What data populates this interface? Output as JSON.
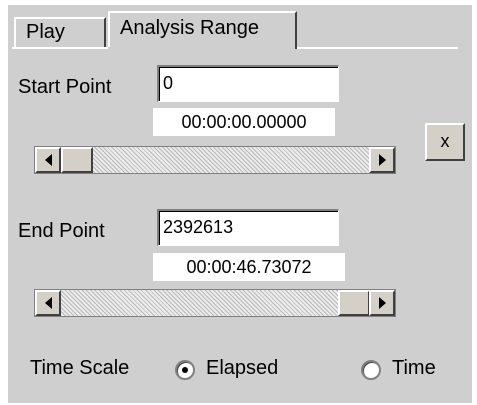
{
  "tabs": [
    {
      "label": "Play",
      "active": false
    },
    {
      "label": "Analysis Range",
      "active": true
    }
  ],
  "start": {
    "label": "Start Point",
    "value": "0",
    "time": "00:00:00.00000",
    "scroll_position": 0.0
  },
  "clear_button": {
    "label": "x"
  },
  "end": {
    "label": "End Point",
    "value": "2392613",
    "time": "00:00:46.73072",
    "scroll_position": 1.0
  },
  "time_scale": {
    "label": "Time Scale",
    "options": [
      {
        "label": "Elapsed",
        "selected": true
      },
      {
        "label": "Time",
        "selected": false
      }
    ]
  },
  "colors": {
    "panel": "#cfcfcf",
    "field": "#ffffff"
  },
  "icons": {
    "scroll_left": "left-arrow-icon",
    "scroll_right": "right-arrow-icon"
  }
}
